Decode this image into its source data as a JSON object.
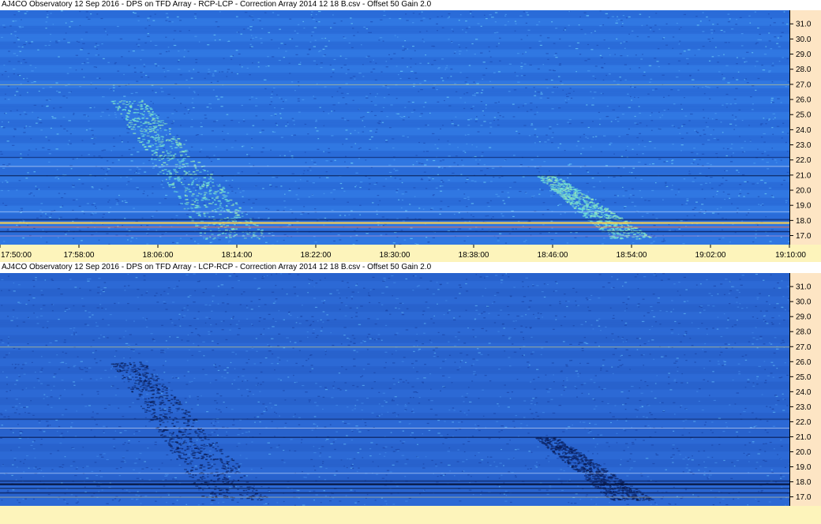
{
  "panels": [
    {
      "title": "AJ4CO Observatory 12 Sep 2016  -  DPS on TFD Array  -  RCP-LCP  -  Correction Array 2014 12 18 B.csv  -  Offset 50  Gain 2.0",
      "mode": "RCP-LCP",
      "emission_tone": "bright"
    },
    {
      "title": "AJ4CO Observatory 12 Sep 2016  -  DPS on TFD Array  -  LCP-RCP  -  Correction Array 2014 12 18 B.csv  -  Offset 50  Gain 2.0",
      "mode": "LCP-RCP",
      "emission_tone": "dark"
    }
  ],
  "colors": {
    "background_blue": "#2a6fdc",
    "axis_panel": "#fde5c4",
    "time_bar": "#fdf4bb"
  },
  "chart_data": [
    {
      "type": "heatmap",
      "title": "AJ4CO Observatory 12 Sep 2016  -  DPS on TFD Array  -  RCP-LCP  -  Correction Array 2014 12 18 B.csv  -  Offset 50  Gain 2.0",
      "x_ticks": [
        "17:50:00",
        "17:58:00",
        "18:06:00",
        "18:14:00",
        "18:22:00",
        "18:30:00",
        "18:38:00",
        "18:46:00",
        "18:54:00",
        "19:02:00",
        "19:10:00"
      ],
      "y_ticks": [
        17.0,
        18.0,
        19.0,
        20.0,
        21.0,
        22.0,
        23.0,
        24.0,
        25.0,
        26.0,
        27.0,
        28.0,
        29.0,
        30.0,
        31.0
      ],
      "ylim": [
        16.4,
        31.9
      ],
      "xlim": [
        "17:50:00",
        "19:10:00"
      ]
    },
    {
      "type": "heatmap",
      "title": "AJ4CO Observatory 12 Sep 2016  -  DPS on TFD Array  -  LCP-RCP  -  Correction Array 2014 12 18 B.csv  -  Offset 50  Gain 2.0",
      "y_ticks": [
        17.0,
        18.0,
        19.0,
        20.0,
        21.0,
        22.0,
        23.0,
        24.0,
        25.0,
        26.0,
        27.0,
        28.0,
        29.0,
        30.0,
        31.0
      ],
      "ylim": [
        16.4,
        31.9
      ]
    }
  ]
}
